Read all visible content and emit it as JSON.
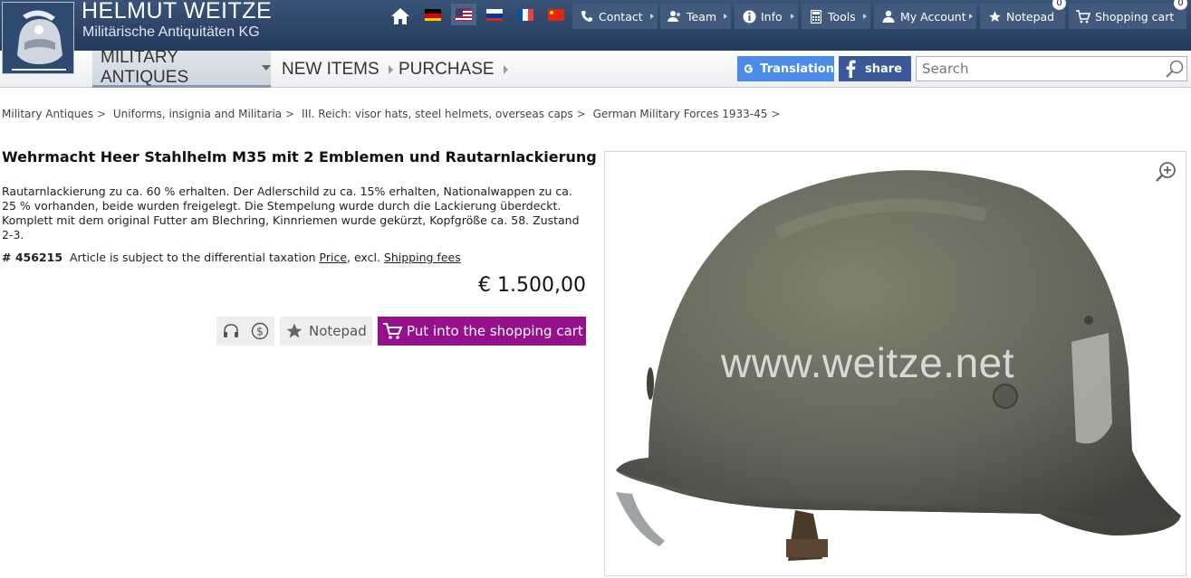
{
  "brand": {
    "name": "HELMUT WEITZE",
    "subtitle": "Militärische Antiquitäten KG"
  },
  "topnav": {
    "flags": [
      "german",
      "usa",
      "russian",
      "french",
      "chinese"
    ],
    "items": {
      "contact": "Contact",
      "team": "Team",
      "info": "Info",
      "tools": "Tools",
      "account": "My Account",
      "notepad": "Notepad",
      "cart": "Shopping cart"
    },
    "notepad_count": "0",
    "cart_count": "0"
  },
  "mainnav": {
    "military_antiques": "MILITARY ANTIQUES",
    "new_items": "NEW ITEMS",
    "purchase": "PURCHASE"
  },
  "tools": {
    "translation_label": "Translation",
    "share_label": "share",
    "search_placeholder": "Search"
  },
  "breadcrumb": [
    "Military Antiques",
    "Uniforms, insignia and Militaria",
    "III. Reich: visor hats, steel helmets, overseas caps",
    "German Military Forces 1933-45"
  ],
  "product": {
    "title": "Wehrmacht Heer Stahlhelm M35 mit 2 Emblemen und Rautarnlackierung",
    "description": "Rautarnlackierung zu ca. 60 % erhalten. Der Adlerschild zu ca. 15% erhalten, Nationalwappen zu ca. 25 % vorhanden, beide wurden freigelegt. Die Stempelung wurde durch die Lackierung überdeckt. Komplett mit dem original Futter am Blechring, Kinnriemen wurde gekürzt, Kopfgröße ca. 58. Zustand 2-3.",
    "article_number": "# 456215",
    "tax_note": "Article is subject to the differential taxation",
    "price_link": "Price",
    "excl": ", excl.",
    "shipping_link": "Shipping fees",
    "price": "€ 1.500,00",
    "notepad_label": "Notepad",
    "cart_label": "Put into the shopping cart",
    "watermark": "www.weitze.net"
  },
  "colors": {
    "topbar": "#2b4266",
    "cart_button": "#96108d",
    "translation_button": "#4a8ce8",
    "share_button": "#3b5998"
  }
}
